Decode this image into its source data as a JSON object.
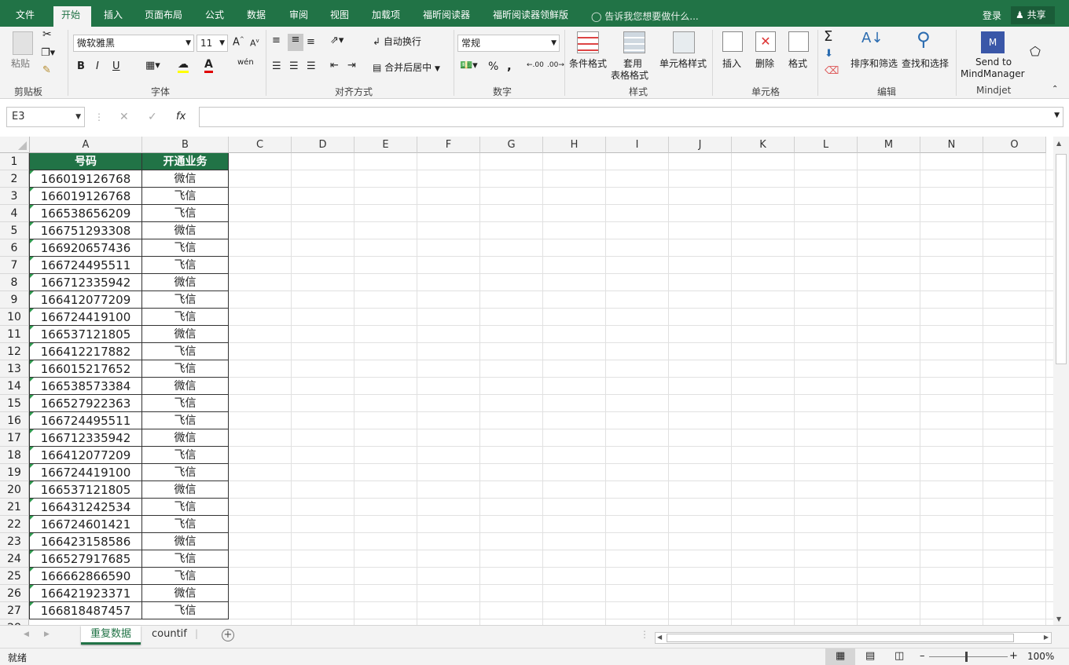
{
  "ribbon_tabs": [
    "文件",
    "开始",
    "插入",
    "页面布局",
    "公式",
    "数据",
    "审阅",
    "视图",
    "加载项",
    "福昕阅读器",
    "福昕阅读器领鲜版"
  ],
  "tell_me": "告诉我您想要做什么...",
  "login": "登录",
  "share": "共享",
  "clipboard": {
    "paste": "粘贴",
    "label": "剪贴板"
  },
  "font": {
    "name": "微软雅黑",
    "size": "11",
    "bold": "B",
    "italic": "I",
    "underline": "U",
    "phonetic": "wén",
    "label": "字体"
  },
  "alignment": {
    "wrap": "自动换行",
    "merge": "合并后居中",
    "label": "对齐方式"
  },
  "number": {
    "format": "常规",
    "label": "数字"
  },
  "styles": {
    "conditional": "条件格式",
    "table_line1": "套用",
    "table_line2": "表格格式",
    "cell_styles": "单元格样式",
    "label": "样式"
  },
  "cells": {
    "insert": "插入",
    "delete": "删除",
    "format": "格式",
    "label": "单元格"
  },
  "editing": {
    "sort": "排序和筛选",
    "find": "查找和选择",
    "label": "编辑"
  },
  "mindjet": {
    "line1": "Send to",
    "line2": "MindManager",
    "label": "Mindjet"
  },
  "namebox": "E3",
  "fx": "fx",
  "columns": [
    "A",
    "B",
    "C",
    "D",
    "E",
    "F",
    "G",
    "H",
    "I",
    "J",
    "K",
    "L",
    "M",
    "N",
    "O"
  ],
  "table": {
    "headers": [
      "号码",
      "开通业务"
    ],
    "rows": [
      [
        "166019126768",
        "微信"
      ],
      [
        "166019126768",
        "飞信"
      ],
      [
        "166538656209",
        "飞信"
      ],
      [
        "166751293308",
        "微信"
      ],
      [
        "166920657436",
        "飞信"
      ],
      [
        "166724495511",
        "飞信"
      ],
      [
        "166712335942",
        "微信"
      ],
      [
        "166412077209",
        "飞信"
      ],
      [
        "166724419100",
        "飞信"
      ],
      [
        "166537121805",
        "微信"
      ],
      [
        "166412217882",
        "飞信"
      ],
      [
        "166015217652",
        "飞信"
      ],
      [
        "166538573384",
        "微信"
      ],
      [
        "166527922363",
        "飞信"
      ],
      [
        "166724495511",
        "飞信"
      ],
      [
        "166712335942",
        "微信"
      ],
      [
        "166412077209",
        "飞信"
      ],
      [
        "166724419100",
        "飞信"
      ],
      [
        "166537121805",
        "微信"
      ],
      [
        "166431242534",
        "飞信"
      ],
      [
        "166724601421",
        "飞信"
      ],
      [
        "166423158586",
        "微信"
      ],
      [
        "166527917685",
        "飞信"
      ],
      [
        "166662866590",
        "飞信"
      ],
      [
        "166421923371",
        "微信"
      ],
      [
        "166818487457",
        "飞信"
      ]
    ]
  },
  "sheets": [
    "重复数据",
    "countif"
  ],
  "status_text": "就绪",
  "zoom": "100%",
  "colors": {
    "accent": "#217346",
    "header_fill": "#217346"
  }
}
